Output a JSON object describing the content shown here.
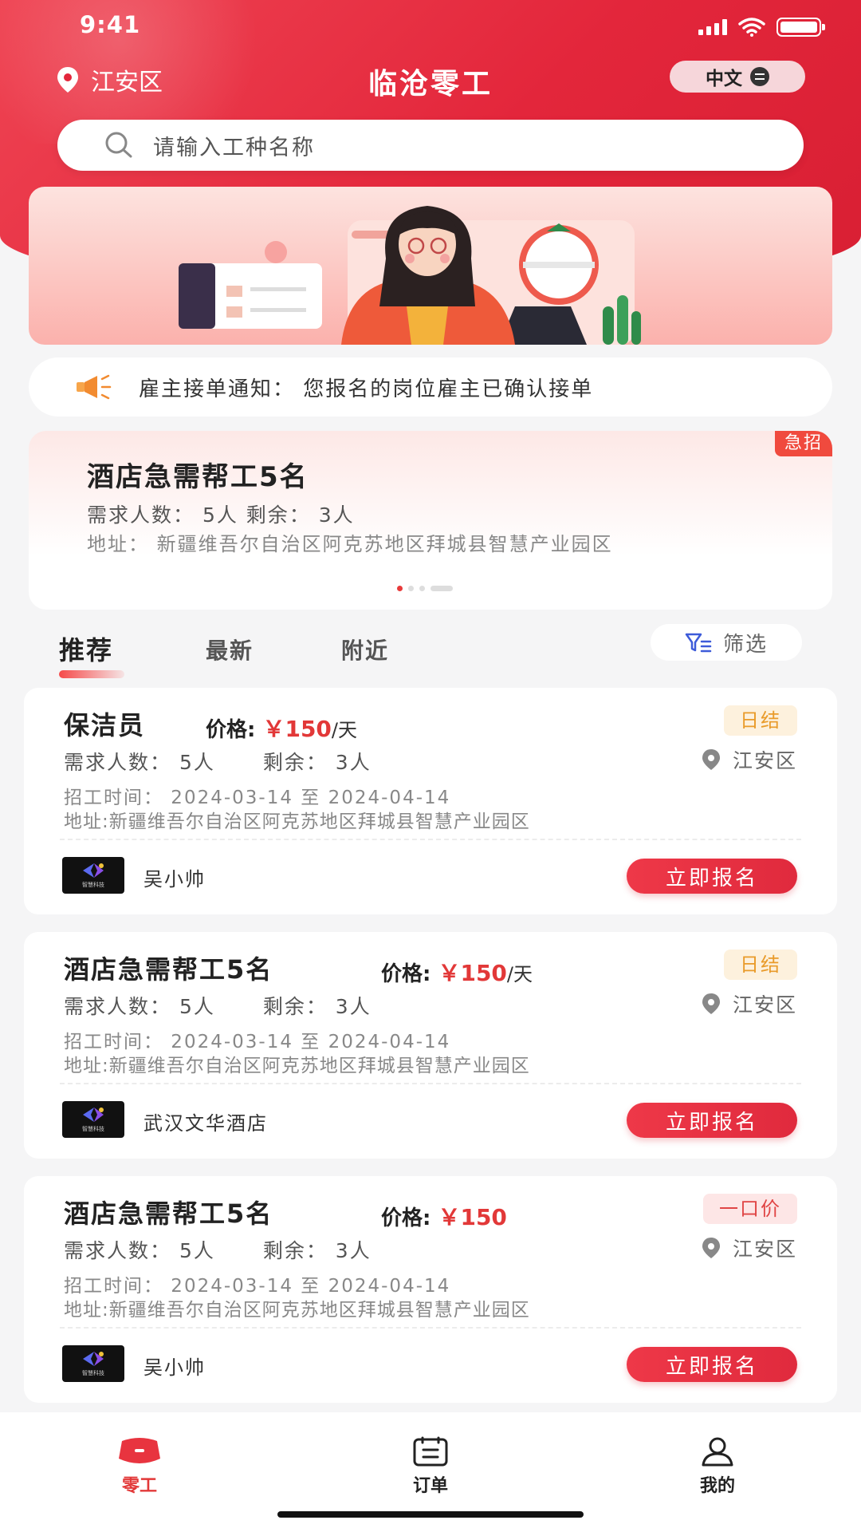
{
  "status_bar": {
    "time": "9:41"
  },
  "header": {
    "location": "江安区",
    "title": "临沧零工",
    "language": "中文"
  },
  "search": {
    "placeholder": "请输入工种名称"
  },
  "notice": {
    "text": "雇主接单通知：  您报名的岗位雇主已确认接单"
  },
  "featured": {
    "tag": "急招",
    "title": "酒店急需帮工5名",
    "requirement": "需求人数：  5人    剩余：  3人",
    "address": "地址：  新疆维吾尔自治区阿克苏地区拜城县智慧产业园区"
  },
  "tabs": [
    {
      "label": "推荐"
    },
    {
      "label": "最新"
    },
    {
      "label": "附近"
    }
  ],
  "filter_label": "筛选",
  "jobs": [
    {
      "title": "保洁员",
      "price_label": "价格:",
      "price": "￥150",
      "unit": "/天",
      "pay_type": "日结",
      "need": "需求人数：  5人",
      "remaining": "剩余：  3人",
      "district": "江安区",
      "time": "招工时间：  2024-03-14 至 2024-04-14",
      "address": "地址:新疆维吾尔自治区阿克苏地区拜城县智慧产业园区",
      "employer": "吴小帅",
      "logo_text": "智慧科技",
      "button": "立即报名"
    },
    {
      "title": "酒店急需帮工5名",
      "price_label": "价格:",
      "price": "￥150",
      "unit": "/天",
      "pay_type": "日结",
      "need": "需求人数：  5人",
      "remaining": "剩余：  3人",
      "district": "江安区",
      "time": "招工时间：  2024-03-14 至 2024-04-14",
      "address": "地址:新疆维吾尔自治区阿克苏地区拜城县智慧产业园区",
      "employer": "武汉文华酒店",
      "logo_text": "智慧科技",
      "button": "立即报名"
    },
    {
      "title": "酒店急需帮工5名",
      "price_label": "价格:",
      "price": "￥150",
      "unit": "",
      "pay_type": "一口价",
      "need": "需求人数：  5人",
      "remaining": "剩余：  3人",
      "district": "江安区",
      "time": "招工时间：  2024-03-14 至 2024-04-14",
      "address": "地址:新疆维吾尔自治区阿克苏地区拜城县智慧产业园区",
      "employer": "吴小帅",
      "logo_text": "智慧科技",
      "button": "立即报名"
    }
  ],
  "bottom_nav": [
    {
      "label": "零工",
      "icon": "gig-icon"
    },
    {
      "label": "订单",
      "icon": "order-icon"
    },
    {
      "label": "我的",
      "icon": "profile-icon"
    }
  ],
  "colors": {
    "brand": "#e3263b",
    "price": "#e23838",
    "daily_tag": "#e99b2a"
  }
}
